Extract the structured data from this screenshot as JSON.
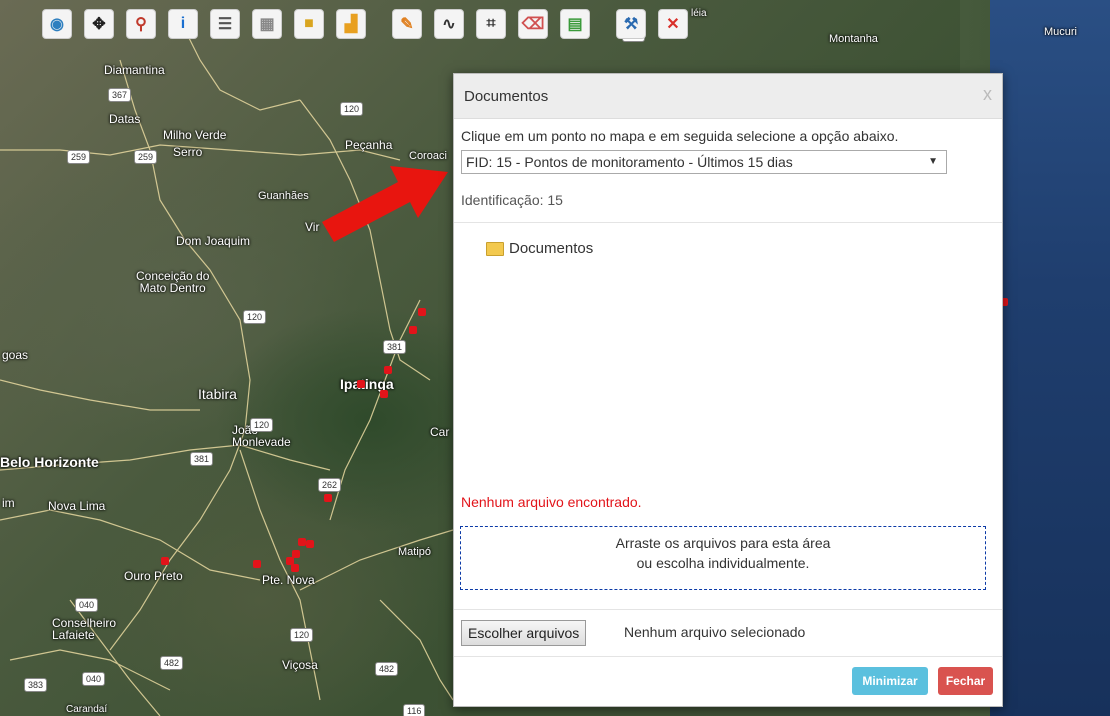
{
  "map": {
    "labels": {
      "diamantina": "Diamantina",
      "datas": "Datas",
      "milho_verde": "Milho Verde",
      "serro": "Serro",
      "pecanha": "Peçanha",
      "coroaci": "Coroaci",
      "guanhaes": "Guanhães",
      "virgolandia": "Vir",
      "dom_joaquim": "Dom Joaquim",
      "conceicao": "Conceição do\nMato Dentro",
      "itabira": "Itabira",
      "ipatinga": "Ipatinga",
      "joao_monlevade": "João\nMonlevade",
      "belo_horizonte": "Belo Horizonte",
      "nova_lima": "Nova Lima",
      "ouro_preto": "Ouro Preto",
      "pte_nova": "Pte. Nova",
      "conselheiro": "Conselheiro\nLafaiete",
      "vicosa": "Viçosa",
      "matipo": "Matipó",
      "montanha": "Montanha",
      "mucuri": "Mucuri",
      "carandai": "Carandaí",
      "goas": "goas",
      "bim": "im",
      "car": "Car",
      "leia": "léia"
    },
    "shields": [
      "367",
      "259",
      "259",
      "120",
      "120",
      "381",
      "120",
      "381",
      "262",
      "040",
      "120",
      "482",
      "482",
      "040",
      "383",
      "116",
      "342"
    ],
    "colors": {
      "ocean": "#1f3e6e",
      "marker": "#e2141a"
    }
  },
  "toolbar": {
    "buttons": [
      {
        "name": "globe-icon",
        "glyph": "◉",
        "color": "#2e7fbf"
      },
      {
        "name": "pan-icon",
        "glyph": "✥",
        "color": "#222"
      },
      {
        "name": "zoom-icon",
        "glyph": "⚲",
        "color": "#c0392b"
      },
      {
        "name": "info-icon",
        "glyph": "i",
        "color": "#1a6fd0"
      },
      {
        "name": "legend-icon",
        "glyph": "☰",
        "color": "#555"
      },
      {
        "name": "grid-icon",
        "glyph": "▦",
        "color": "#888"
      },
      {
        "name": "layers-folder-icon",
        "glyph": "■",
        "color": "#d9a520"
      },
      {
        "name": "tree-icon",
        "glyph": "▟",
        "color": "#e8a020"
      },
      {
        "name": "draw-line-icon",
        "glyph": "✎",
        "color": "#e08020"
      },
      {
        "name": "polyline-icon",
        "glyph": "∿",
        "color": "#333"
      },
      {
        "name": "polygon-icon",
        "glyph": "⌗",
        "color": "#333"
      },
      {
        "name": "eraser-icon",
        "glyph": "⌫",
        "color": "#d05050"
      },
      {
        "name": "grid-color-icon",
        "glyph": "▤",
        "color": "#3a9a3a"
      },
      {
        "name": "tools-icon",
        "glyph": "⚒",
        "color": "#2a6ab0"
      },
      {
        "name": "close-circle-icon",
        "glyph": "✕",
        "color": "#d9302a"
      }
    ]
  },
  "modal": {
    "title": "Documentos",
    "close": "x",
    "instruction": "Clique em um ponto no mapa e em seguida selecione a opção abaixo.",
    "select_value": "FID: 15 - Pontos de monitoramento - Últimos 15 dias",
    "identification": "Identificação: 15",
    "folder": "Documentos",
    "no_files": "Nenhum arquivo encontrado.",
    "drop_line1": "Arraste os arquivos para esta área",
    "drop_line2": "ou escolha individualmente.",
    "file_button": "Escolher arquivos",
    "file_status": "Nenhum arquivo selecionado",
    "minimize": "Minimizar",
    "close_button": "Fechar"
  }
}
